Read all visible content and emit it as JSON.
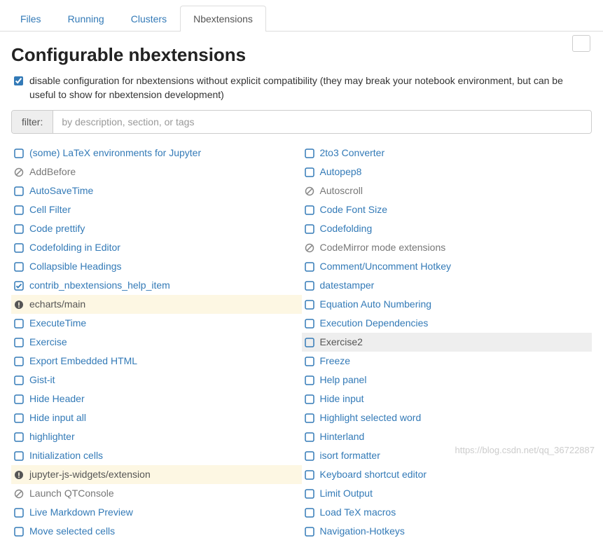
{
  "tabs": {
    "files": "Files",
    "running": "Running",
    "clusters": "Clusters",
    "nbextensions": "Nbextensions"
  },
  "refresh_icon": "↻",
  "title": "Configurable nbextensions",
  "compat_checkbox_label": "disable configuration for nbextensions without explicit compatibility (they may break your notebook environment, but can be useful to show for nbextension development)",
  "filter": {
    "label": "filter:",
    "placeholder": "by description, section, or tags"
  },
  "extensions": {
    "left": [
      {
        "name": "(some) LaTeX environments for Jupyter",
        "state": "unchecked"
      },
      {
        "name": "AddBefore",
        "state": "forbidden"
      },
      {
        "name": "AutoSaveTime",
        "state": "unchecked"
      },
      {
        "name": "Cell Filter",
        "state": "unchecked"
      },
      {
        "name": "Code prettify",
        "state": "unchecked"
      },
      {
        "name": "Codefolding in Editor",
        "state": "unchecked"
      },
      {
        "name": "Collapsible Headings",
        "state": "unchecked"
      },
      {
        "name": "contrib_nbextensions_help_item",
        "state": "checked"
      },
      {
        "name": "echarts/main",
        "state": "warn"
      },
      {
        "name": "ExecuteTime",
        "state": "unchecked"
      },
      {
        "name": "Exercise",
        "state": "unchecked"
      },
      {
        "name": "Export Embedded HTML",
        "state": "unchecked"
      },
      {
        "name": "Gist-it",
        "state": "unchecked"
      },
      {
        "name": "Hide Header",
        "state": "unchecked"
      },
      {
        "name": "Hide input all",
        "state": "unchecked"
      },
      {
        "name": "highlighter",
        "state": "unchecked"
      },
      {
        "name": "Initialization cells",
        "state": "unchecked"
      },
      {
        "name": "jupyter-js-widgets/extension",
        "state": "warn"
      },
      {
        "name": "Launch QTConsole",
        "state": "forbidden"
      },
      {
        "name": "Live Markdown Preview",
        "state": "unchecked"
      },
      {
        "name": "Move selected cells",
        "state": "unchecked"
      }
    ],
    "right": [
      {
        "name": "2to3 Converter",
        "state": "unchecked"
      },
      {
        "name": "Autopep8",
        "state": "unchecked"
      },
      {
        "name": "Autoscroll",
        "state": "forbidden"
      },
      {
        "name": "Code Font Size",
        "state": "unchecked"
      },
      {
        "name": "Codefolding",
        "state": "unchecked"
      },
      {
        "name": "CodeMirror mode extensions",
        "state": "forbidden"
      },
      {
        "name": "Comment/Uncomment Hotkey",
        "state": "unchecked"
      },
      {
        "name": "datestamper",
        "state": "unchecked"
      },
      {
        "name": "Equation Auto Numbering",
        "state": "unchecked"
      },
      {
        "name": "Execution Dependencies",
        "state": "unchecked"
      },
      {
        "name": "Exercise2",
        "state": "unchecked",
        "hover": true
      },
      {
        "name": "Freeze",
        "state": "unchecked"
      },
      {
        "name": "Help panel",
        "state": "unchecked"
      },
      {
        "name": "Hide input",
        "state": "unchecked"
      },
      {
        "name": "Highlight selected word",
        "state": "unchecked"
      },
      {
        "name": "Hinterland",
        "state": "unchecked"
      },
      {
        "name": "isort formatter",
        "state": "unchecked"
      },
      {
        "name": "Keyboard shortcut editor",
        "state": "unchecked"
      },
      {
        "name": "Limit Output",
        "state": "unchecked"
      },
      {
        "name": "Load TeX macros",
        "state": "unchecked"
      },
      {
        "name": "Navigation-Hotkeys",
        "state": "unchecked"
      }
    ]
  },
  "watermark": "https://blog.csdn.net/qq_36722887"
}
